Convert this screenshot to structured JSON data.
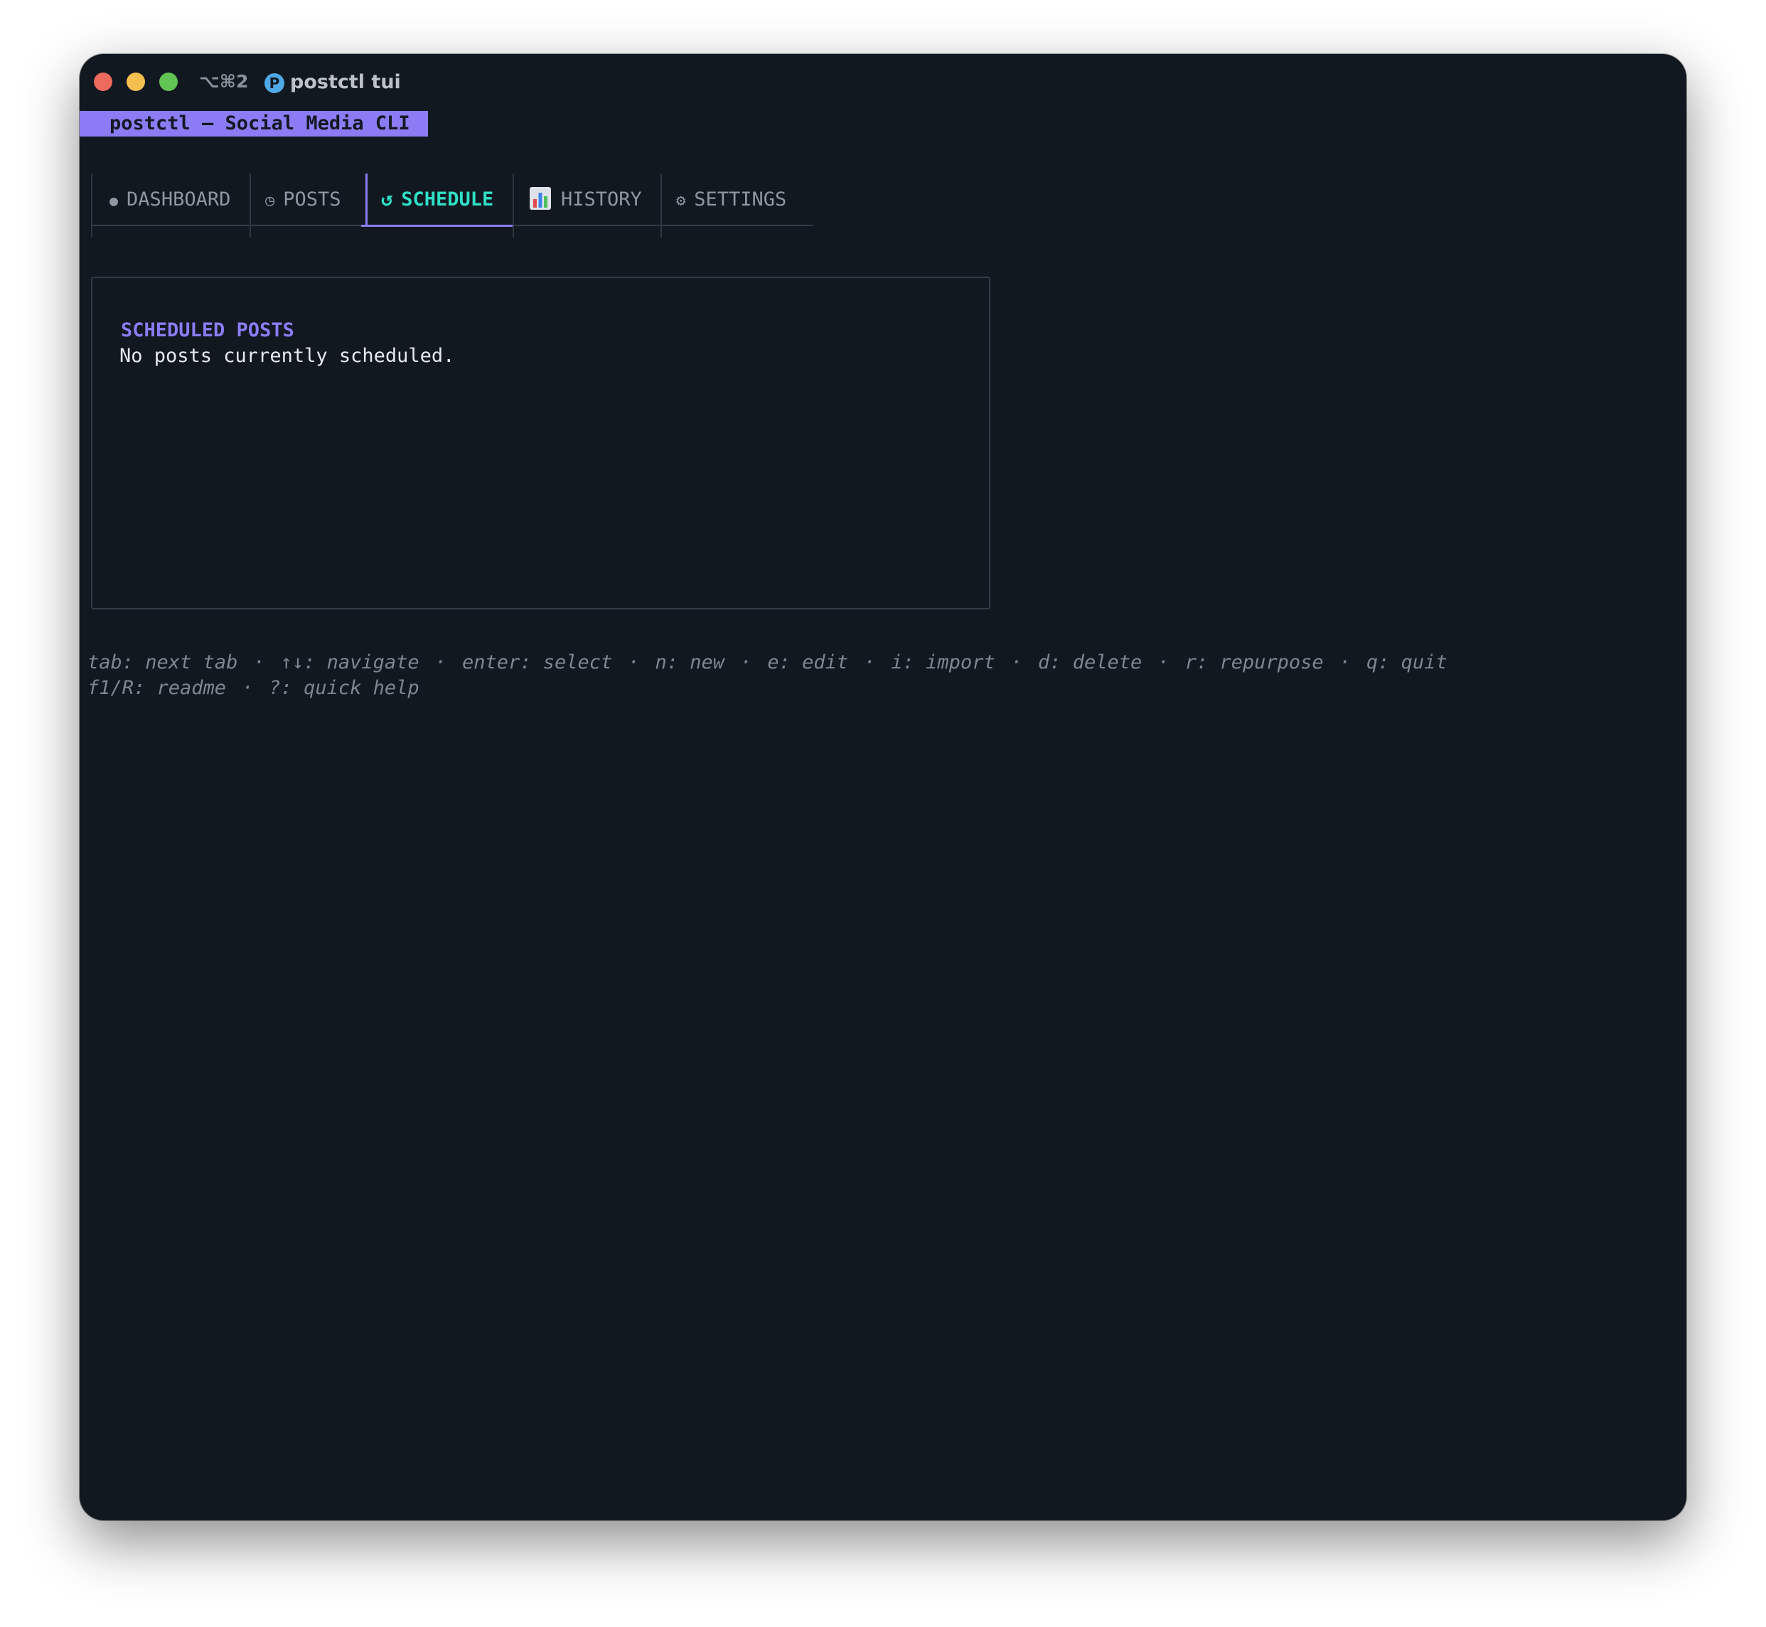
{
  "titlebar": {
    "shortcut": "⌥⌘2",
    "app_icon_letter": "P",
    "title": "postctl tui"
  },
  "banner": {
    "text": "postctl — Social Media CLI"
  },
  "tabs": [
    {
      "icon": "●",
      "icon_name": "dot-icon",
      "label": "DASHBOARD"
    },
    {
      "icon": "◷",
      "icon_name": "clock-icon",
      "label": "POSTS"
    },
    {
      "icon": "↺",
      "icon_name": "refresh-icon",
      "label": "SCHEDULE",
      "active": true
    },
    {
      "icon": "📊",
      "icon_name": "chart-icon",
      "label": "HISTORY"
    },
    {
      "icon": "⚙",
      "icon_name": "gear-icon",
      "label": "SETTINGS"
    }
  ],
  "panel": {
    "title": "SCHEDULED POSTS",
    "message": "No posts currently scheduled."
  },
  "help": {
    "separator": "·",
    "line1": [
      "tab: next tab",
      "↑↓: navigate",
      "enter: select",
      "n: new",
      "e: edit",
      "i: import",
      "d: delete",
      "r: repurpose",
      "q: quit"
    ],
    "line2": [
      "f1/R: readme",
      "?: quick help"
    ]
  },
  "colors": {
    "background": "#121820",
    "accent": "#8b7cf6",
    "active_tab": "#2fe0c6",
    "muted": "#7d8693"
  }
}
